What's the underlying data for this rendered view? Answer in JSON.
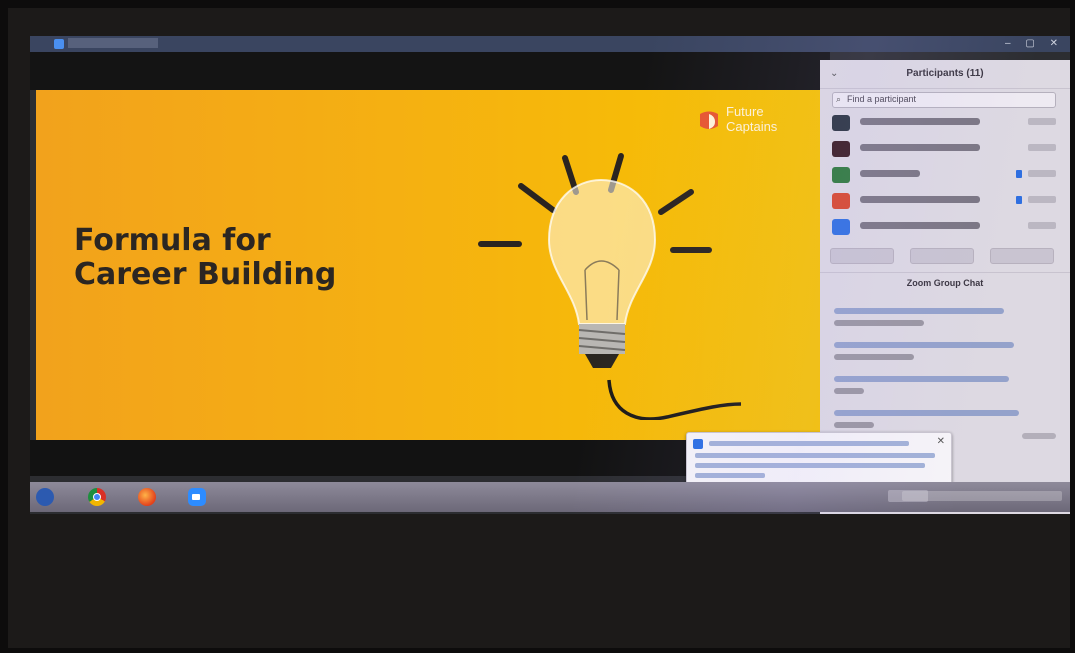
{
  "window": {
    "controls": "– ▢ ✕"
  },
  "slide": {
    "title_line1": "Formula for",
    "title_line2": "Career Building",
    "brand_line1": "Future",
    "brand_line2": "Captains"
  },
  "participants": {
    "header": "Participants (11)",
    "search_placeholder": "Find a participant",
    "list": [
      {
        "color": "#2b3440"
      },
      {
        "color": "#3a1c22"
      },
      {
        "color": "#2e7a3a"
      },
      {
        "color": "#d9472b"
      },
      {
        "color": "#2f6fe0"
      }
    ]
  },
  "chat": {
    "header": "Zoom Group Chat"
  },
  "colors": {
    "slide_bg": "#f5b012",
    "slide_text": "#2b2622",
    "panel_bg": "#ddd9e2",
    "accent": "#2d8cff"
  }
}
